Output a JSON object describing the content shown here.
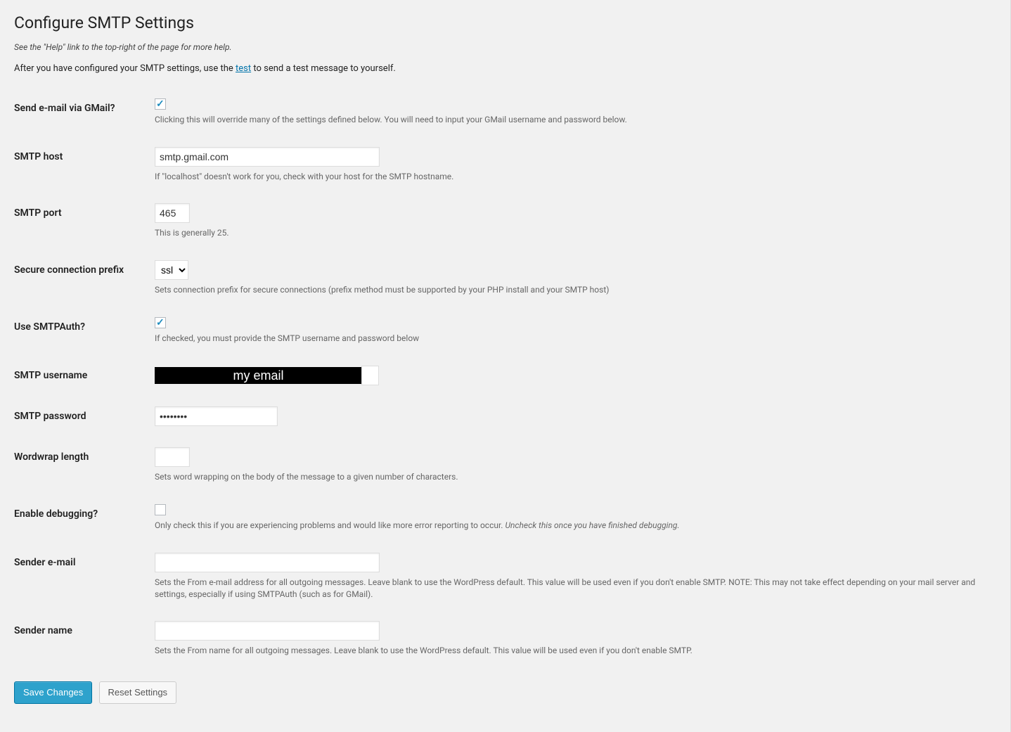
{
  "page": {
    "title": "Configure SMTP Settings",
    "help_note": "See the \"Help\" link to the top-right of the page for more help.",
    "intro_before": "After you have configured your SMTP settings, use the ",
    "intro_link": "test",
    "intro_after": " to send a test message to yourself."
  },
  "fields": {
    "gmail": {
      "label": "Send e-mail via GMail?",
      "checked": true,
      "desc": "Clicking this will override many of the settings defined below. You will need to input your GMail username and password below."
    },
    "host": {
      "label": "SMTP host",
      "value": "smtp.gmail.com",
      "desc": "If \"localhost\" doesn't work for you, check with your host for the SMTP hostname."
    },
    "port": {
      "label": "SMTP port",
      "value": "465",
      "desc": "This is generally 25."
    },
    "secure": {
      "label": "Secure connection prefix",
      "value": "ssl",
      "desc": "Sets connection prefix for secure connections (prefix method must be supported by your PHP install and your SMTP host)"
    },
    "smtpauth": {
      "label": "Use SMTPAuth?",
      "checked": true,
      "desc": "If checked, you must provide the SMTP username and password below"
    },
    "username": {
      "label": "SMTP username",
      "redacted_text": "my email"
    },
    "password": {
      "label": "SMTP password",
      "value": "••••••••"
    },
    "wordwrap": {
      "label": "Wordwrap length",
      "value": "",
      "desc": "Sets word wrapping on the body of the message to a given number of characters."
    },
    "debug": {
      "label": "Enable debugging?",
      "checked": false,
      "desc_main": "Only check this if you are experiencing problems and would like more error reporting to occur. ",
      "desc_em": "Uncheck this once you have finished debugging."
    },
    "sender_email": {
      "label": "Sender e-mail",
      "value": "",
      "desc": "Sets the From e-mail address for all outgoing messages. Leave blank to use the WordPress default. This value will be used even if you don't enable SMTP. NOTE: This may not take effect depending on your mail server and settings, especially if using SMTPAuth (such as for GMail)."
    },
    "sender_name": {
      "label": "Sender name",
      "value": "",
      "desc": "Sets the From name for all outgoing messages. Leave blank to use the WordPress default. This value will be used even if you don't enable SMTP."
    }
  },
  "buttons": {
    "save": "Save Changes",
    "reset": "Reset Settings"
  }
}
